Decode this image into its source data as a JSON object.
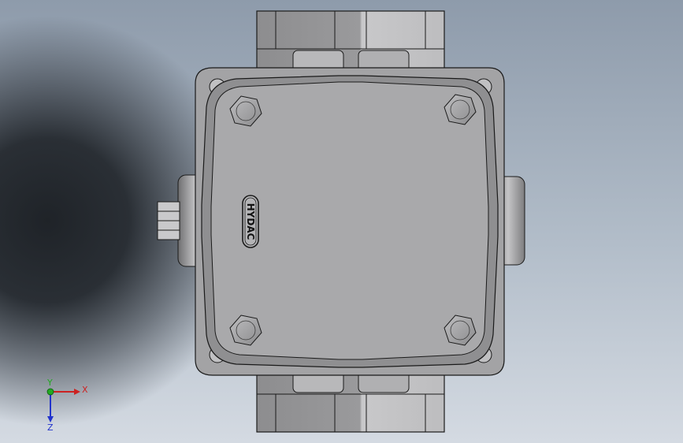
{
  "viewport": {
    "colors": {
      "background_dark": "#1f2328",
      "background_light": "#c4ccd6",
      "part_body": "#8f8f91",
      "part_face": "#a9a9ab",
      "part_edge": "#1a1a1a"
    }
  },
  "part": {
    "logo_text": "HYDAC"
  },
  "triad": {
    "x_label": "X",
    "y_label": "Y",
    "z_label": "Z",
    "x_color": "#cc2222",
    "y_color": "#22aa22",
    "z_color": "#2233cc"
  }
}
